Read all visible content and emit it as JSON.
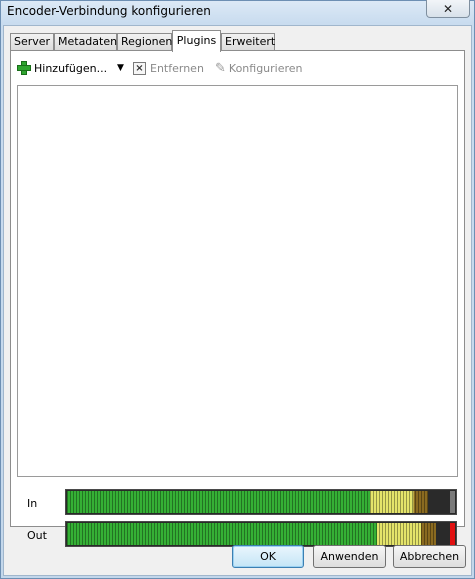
{
  "window": {
    "title": "Encoder-Verbindung konfigurieren",
    "close_glyph": "✕"
  },
  "tabs": [
    {
      "label": "Server",
      "active": false
    },
    {
      "label": "Metadaten",
      "active": false
    },
    {
      "label": "Regionen",
      "active": false
    },
    {
      "label": "Plugins",
      "active": true
    },
    {
      "label": "Erweitert",
      "active": false
    }
  ],
  "toolbar": {
    "add_label": "Hinzufügen...",
    "add_icon": "plus-icon",
    "dropdown_glyph": "▼",
    "remove_label": "Entfernen",
    "remove_icon": "x-icon",
    "configure_label": "Konfigurieren",
    "configure_icon": "pencil-icon"
  },
  "plugin_list": [],
  "meters": [
    {
      "label": "In",
      "level": 0.93,
      "peak_color": "#7a7a7a"
    },
    {
      "label": "Out",
      "level": 0.95,
      "peak_color": "#e01010"
    }
  ],
  "buttons": {
    "ok": "OK",
    "apply": "Anwenden",
    "cancel": "Abbrechen"
  },
  "colors": {
    "accent_default_button": "#3c7fb1",
    "meter_green": "#35b035",
    "meter_yellow": "#e4e46a"
  }
}
